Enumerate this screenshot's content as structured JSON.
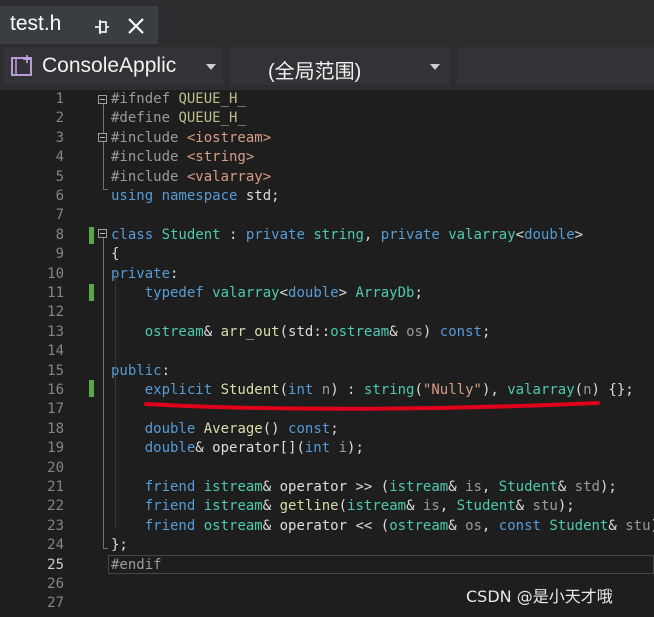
{
  "tab": {
    "title": "test.h",
    "pin_icon": "pin-icon",
    "close_icon": "close-icon"
  },
  "nav": {
    "project": "ConsoleApplic",
    "scope": "(全局范围)"
  },
  "editor": {
    "line_numbers": [
      "1",
      "2",
      "3",
      "4",
      "5",
      "6",
      "7",
      "8",
      "9",
      "10",
      "11",
      "12",
      "13",
      "14",
      "15",
      "16",
      "17",
      "18",
      "19",
      "20",
      "21",
      "22",
      "23",
      "24",
      "25",
      "26",
      "27"
    ],
    "current_line": "25",
    "lines": [
      [
        [
          "pp",
          "#ifndef "
        ],
        [
          "mac",
          "QUEUE_H_"
        ]
      ],
      [
        [
          "pp",
          "#define "
        ],
        [
          "mac",
          "QUEUE_H_"
        ]
      ],
      [
        [
          "pp",
          "#include "
        ],
        [
          "inc",
          "<iostream>"
        ]
      ],
      [
        [
          "pp",
          "#include "
        ],
        [
          "inc",
          "<string>"
        ]
      ],
      [
        [
          "pp",
          "#include "
        ],
        [
          "inc",
          "<valarray>"
        ]
      ],
      [
        [
          "kw",
          "using namespace "
        ],
        [
          "txt",
          "std;"
        ]
      ],
      [],
      [
        [
          "kw",
          "class "
        ],
        [
          "ty",
          "Student"
        ],
        [
          "txt",
          " : "
        ],
        [
          "kw",
          "private "
        ],
        [
          "ty",
          "string"
        ],
        [
          "txt",
          ", "
        ],
        [
          "kw",
          "private "
        ],
        [
          "ty",
          "valarray"
        ],
        [
          "txt",
          "<"
        ],
        [
          "kw",
          "double"
        ],
        [
          "txt",
          ">"
        ]
      ],
      [
        [
          "txt",
          "{"
        ]
      ],
      [
        [
          "kw",
          "private"
        ],
        [
          "txt",
          ":"
        ]
      ],
      [
        [
          "txt",
          "    "
        ],
        [
          "kw",
          "typedef "
        ],
        [
          "ty",
          "valarray"
        ],
        [
          "txt",
          "<"
        ],
        [
          "kw",
          "double"
        ],
        [
          "txt",
          "> "
        ],
        [
          "ty",
          "ArrayDb"
        ],
        [
          "txt",
          ";"
        ]
      ],
      [],
      [
        [
          "txt",
          "    "
        ],
        [
          "ty",
          "ostream"
        ],
        [
          "txt",
          "& "
        ],
        [
          "fn",
          "arr_out"
        ],
        [
          "txt",
          "(std::"
        ],
        [
          "ty",
          "ostream"
        ],
        [
          "txt",
          "& "
        ],
        [
          "par",
          "os"
        ],
        [
          "txt",
          ") "
        ],
        [
          "kw",
          "const"
        ],
        [
          "txt",
          ";"
        ]
      ],
      [],
      [
        [
          "kw",
          "public"
        ],
        [
          "txt",
          ":"
        ]
      ],
      [
        [
          "txt",
          "    "
        ],
        [
          "kw",
          "explicit "
        ],
        [
          "fn",
          "Student"
        ],
        [
          "txt",
          "("
        ],
        [
          "kw",
          "int "
        ],
        [
          "par",
          "n"
        ],
        [
          "txt",
          ") : "
        ],
        [
          "ty",
          "string"
        ],
        [
          "txt",
          "("
        ],
        [
          "str",
          "\"Nully\""
        ],
        [
          "txt",
          "), "
        ],
        [
          "ty",
          "valarray"
        ],
        [
          "txt",
          "("
        ],
        [
          "par",
          "n"
        ],
        [
          "txt",
          ") {};"
        ]
      ],
      [],
      [
        [
          "txt",
          "    "
        ],
        [
          "kw",
          "double "
        ],
        [
          "fn",
          "Average"
        ],
        [
          "txt",
          "() "
        ],
        [
          "kw",
          "const"
        ],
        [
          "txt",
          ";"
        ]
      ],
      [
        [
          "txt",
          "    "
        ],
        [
          "kw",
          "double"
        ],
        [
          "txt",
          "& operator[]("
        ],
        [
          "kw",
          "int "
        ],
        [
          "par",
          "i"
        ],
        [
          "txt",
          ");"
        ]
      ],
      [],
      [
        [
          "txt",
          "    "
        ],
        [
          "kw",
          "friend "
        ],
        [
          "ty",
          "istream"
        ],
        [
          "txt",
          "& operator >> ("
        ],
        [
          "ty",
          "istream"
        ],
        [
          "txt",
          "& "
        ],
        [
          "par",
          "is"
        ],
        [
          "txt",
          ", "
        ],
        [
          "ty",
          "Student"
        ],
        [
          "txt",
          "& "
        ],
        [
          "par",
          "std"
        ],
        [
          "txt",
          ");"
        ]
      ],
      [
        [
          "txt",
          "    "
        ],
        [
          "kw",
          "friend "
        ],
        [
          "ty",
          "istream"
        ],
        [
          "txt",
          "& "
        ],
        [
          "fn",
          "getline"
        ],
        [
          "txt",
          "("
        ],
        [
          "ty",
          "istream"
        ],
        [
          "txt",
          "& "
        ],
        [
          "par",
          "is"
        ],
        [
          "txt",
          ", "
        ],
        [
          "ty",
          "Student"
        ],
        [
          "txt",
          "& "
        ],
        [
          "par",
          "stu"
        ],
        [
          "txt",
          ");"
        ]
      ],
      [
        [
          "txt",
          "    "
        ],
        [
          "kw",
          "friend "
        ],
        [
          "ty",
          "ostream"
        ],
        [
          "txt",
          "& operator << ("
        ],
        [
          "ty",
          "ostream"
        ],
        [
          "txt",
          "& "
        ],
        [
          "par",
          "os"
        ],
        [
          "txt",
          ", "
        ],
        [
          "kw",
          "const "
        ],
        [
          "ty",
          "Student"
        ],
        [
          "txt",
          "& "
        ],
        [
          "par",
          "stu"
        ],
        [
          "txt",
          ");"
        ]
      ],
      [
        [
          "txt",
          "};"
        ]
      ],
      [
        [
          "pp",
          "#endif"
        ]
      ],
      [],
      []
    ]
  },
  "watermark": "CSDN @是小天才哦",
  "colors": {
    "keyword": "#569cd6",
    "type": "#4ec9b0",
    "function": "#dcdcaa",
    "string": "#d69d85",
    "annotation": "#e0001b"
  }
}
